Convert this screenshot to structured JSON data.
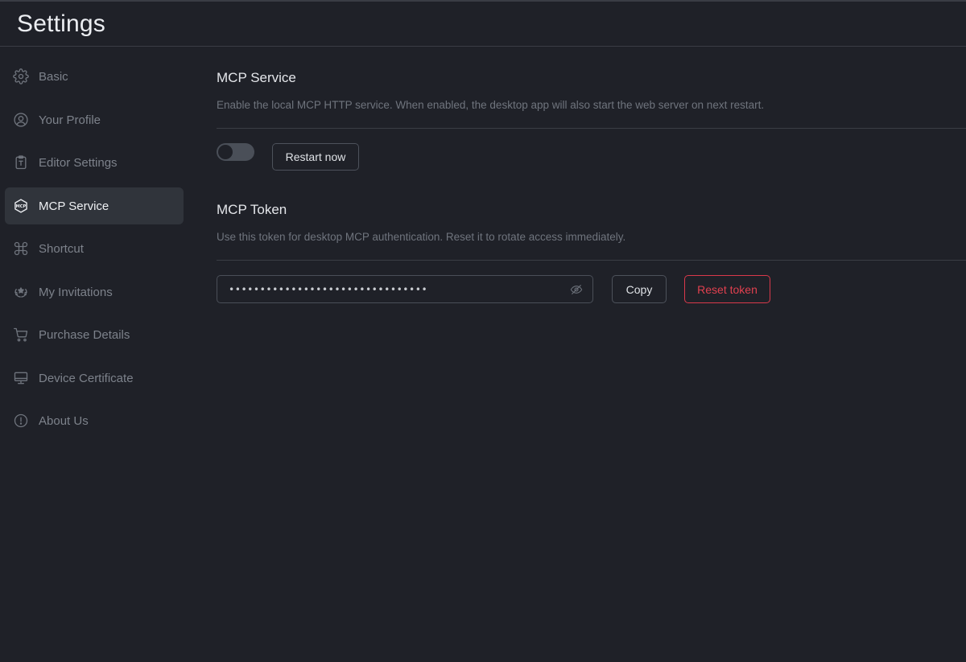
{
  "header": {
    "title": "Settings"
  },
  "sidebar": {
    "items": [
      {
        "label": "Basic",
        "icon": "gear-icon"
      },
      {
        "label": "Your Profile",
        "icon": "user-circle-icon"
      },
      {
        "label": "Editor Settings",
        "icon": "clipboard-text-icon"
      },
      {
        "label": "MCP Service",
        "icon": "mcp-cube-icon",
        "active": true
      },
      {
        "label": "Shortcut",
        "icon": "command-icon"
      },
      {
        "label": "My Invitations",
        "icon": "laurel-icon"
      },
      {
        "label": "Purchase Details",
        "icon": "cart-icon"
      },
      {
        "label": "Device Certificate",
        "icon": "monitor-icon"
      },
      {
        "label": "About Us",
        "icon": "info-circle-icon"
      }
    ]
  },
  "mcp_service": {
    "title": "MCP Service",
    "description": "Enable the local MCP HTTP service. When enabled, the desktop app will also start the web server on next restart.",
    "toggle_enabled": false,
    "restart_label": "Restart now"
  },
  "mcp_token": {
    "title": "MCP Token",
    "description": "Use this token for desktop MCP authentication. Reset it to rotate access immediately.",
    "masked_value": "••••••••••••••••••••••••••••••••",
    "copy_label": "Copy",
    "reset_label": "Reset token"
  },
  "colors": {
    "background": "#1f2128",
    "active_item": "#30343b",
    "danger": "#d9394b"
  }
}
